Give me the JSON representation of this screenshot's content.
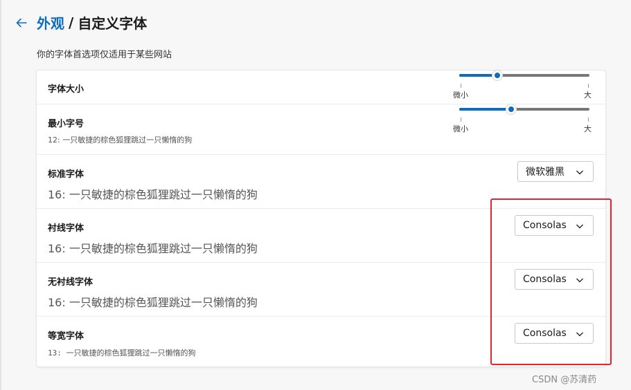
{
  "header": {
    "back_icon": "arrow-left-icon",
    "crumb_parent": "外观",
    "crumb_sep": "/",
    "crumb_current": "自定义字体"
  },
  "note": "你的字体首选项仅适用于某些网站",
  "rows": {
    "font_size": {
      "label": "字体大小",
      "min_label": "微小",
      "max_label": "大",
      "value_fraction": 0.29
    },
    "min_font": {
      "label": "最小字号",
      "sample": "12: 一只敏捷的棕色狐狸跳过一只懒惰的狗",
      "min_label": "微小",
      "max_label": "大",
      "value_fraction": 0.4
    },
    "standard": {
      "label": "标准字体",
      "sample": "16: 一只敏捷的棕色狐狸跳过一只懒惰的狗",
      "value": "微软雅黑"
    },
    "serif": {
      "label": "衬线字体",
      "sample": "16: 一只敏捷的棕色狐狸跳过一只懒惰的狗",
      "value": "Consolas"
    },
    "sans_serif": {
      "label": "无衬线字体",
      "sample": "16: 一只敏捷的棕色狐狸跳过一只懒惰的狗",
      "value": "Consolas"
    },
    "fixed": {
      "label": "等宽字体",
      "sample": "13: 一只敏捷的棕色狐狸跳过一只懒惰的狗",
      "value": "Consolas"
    }
  },
  "colors": {
    "accent": "#0f6cbd",
    "highlight": "#e8222d"
  },
  "watermark": "CSDN @苏清药"
}
